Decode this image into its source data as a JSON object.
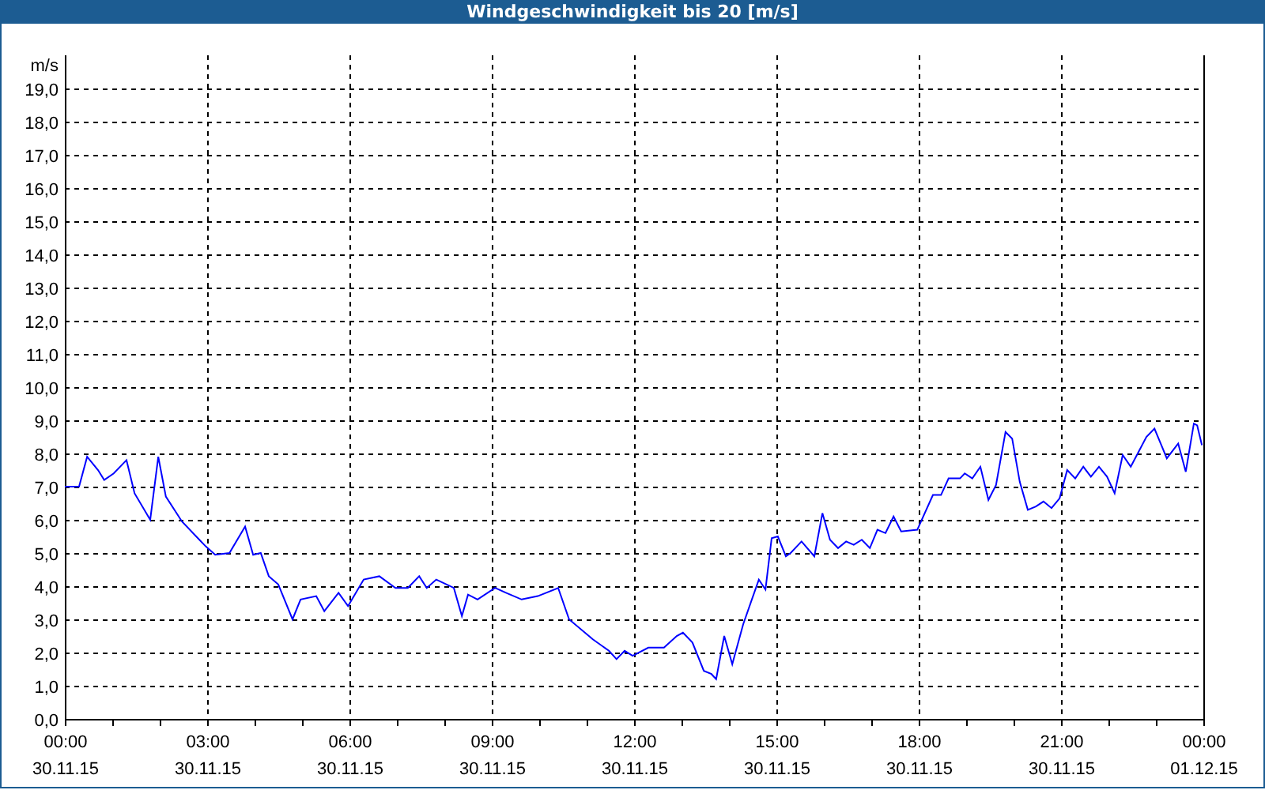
{
  "chart_data": {
    "type": "line",
    "title": "Windgeschwindigkeit bis 20 [m/s]",
    "ylabel": "m/s",
    "xlim": [
      0,
      24
    ],
    "ylim": [
      0,
      20
    ],
    "grid": true,
    "xticks": [
      {
        "value": 0,
        "label": "00:00"
      },
      {
        "value": 3,
        "label": "03:00"
      },
      {
        "value": 6,
        "label": "06:00"
      },
      {
        "value": 9,
        "label": "09:00"
      },
      {
        "value": 12,
        "label": "12:00"
      },
      {
        "value": 15,
        "label": "15:00"
      },
      {
        "value": 18,
        "label": "18:00"
      },
      {
        "value": 21,
        "label": "21:00"
      },
      {
        "value": 24,
        "label": "00:00"
      }
    ],
    "annotations": [
      "30.11.15",
      "30.11.15",
      "30.11.15",
      "30.11.15",
      "30.11.15",
      "30.11.15",
      "30.11.15",
      "30.11.15",
      "01.12.15"
    ],
    "yticks": [
      {
        "value": 0,
        "label": "0,0"
      },
      {
        "value": 1,
        "label": "1,0"
      },
      {
        "value": 2,
        "label": "2,0"
      },
      {
        "value": 3,
        "label": "3,0"
      },
      {
        "value": 4,
        "label": "4,0"
      },
      {
        "value": 5,
        "label": "5,0"
      },
      {
        "value": 6,
        "label": "6,0"
      },
      {
        "value": 7,
        "label": "7,0"
      },
      {
        "value": 8,
        "label": "8,0"
      },
      {
        "value": 9,
        "label": "9,0"
      },
      {
        "value": 10,
        "label": "10,0"
      },
      {
        "value": 11,
        "label": "11,0"
      },
      {
        "value": 12,
        "label": "12,0"
      },
      {
        "value": 13,
        "label": "13,0"
      },
      {
        "value": 14,
        "label": "14,0"
      },
      {
        "value": 15,
        "label": "15,0"
      },
      {
        "value": 16,
        "label": "16,0"
      },
      {
        "value": 17,
        "label": "17,0"
      },
      {
        "value": 18,
        "label": "18,0"
      },
      {
        "value": 19,
        "label": "19,0"
      }
    ],
    "x": [
      0,
      0.3,
      0.47,
      0.7,
      0.83,
      1.03,
      1.3,
      1.47,
      1.8,
      1.97,
      2.13,
      2.47,
      2.97,
      3.17,
      3.47,
      3.8,
      3.97,
      4.13,
      4.3,
      4.5,
      4.8,
      4.97,
      5.3,
      5.47,
      5.77,
      5.97,
      6.3,
      6.63,
      6.97,
      7.23,
      7.47,
      7.63,
      7.83,
      8.2,
      8.37,
      8.5,
      8.7,
      9.07,
      9.3,
      9.63,
      9.97,
      10.4,
      10.63,
      11.13,
      11.47,
      11.63,
      11.8,
      11.97,
      12.3,
      12.63,
      12.9,
      13.03,
      13.23,
      13.47,
      13.63,
      13.73,
      13.9,
      14.07,
      14.3,
      14.63,
      14.77,
      14.9,
      15.03,
      15.2,
      15.3,
      15.53,
      15.8,
      15.97,
      16.13,
      16.3,
      16.47,
      16.63,
      16.8,
      16.97,
      17.13,
      17.3,
      17.47,
      17.63,
      17.97,
      18.3,
      18.47,
      18.63,
      18.87,
      18.97,
      19.13,
      19.3,
      19.47,
      19.63,
      19.83,
      19.97,
      20.13,
      20.3,
      20.47,
      20.63,
      20.8,
      20.97,
      21.13,
      21.3,
      21.47,
      21.63,
      21.8,
      21.97,
      22.13,
      22.3,
      22.47,
      22.8,
      22.97,
      23.13,
      23.23,
      23.47,
      23.63,
      23.8,
      23.87,
      23.97
    ],
    "series": [
      {
        "color": "#0000ff",
        "values": [
          7.0,
          7.0,
          7.9,
          7.5,
          7.2,
          7.4,
          7.8,
          6.8,
          6.0,
          7.9,
          6.7,
          5.95,
          5.2,
          4.95,
          5.0,
          5.8,
          4.95,
          5.0,
          4.3,
          4.05,
          3.0,
          3.6,
          3.7,
          3.25,
          3.8,
          3.4,
          4.2,
          4.3,
          3.95,
          3.95,
          4.3,
          3.95,
          4.2,
          3.95,
          3.1,
          3.75,
          3.6,
          3.95,
          3.8,
          3.6,
          3.7,
          3.95,
          3.0,
          2.4,
          2.05,
          1.8,
          2.05,
          1.9,
          2.15,
          2.15,
          2.5,
          2.6,
          2.3,
          1.45,
          1.35,
          1.2,
          2.5,
          1.65,
          2.85,
          4.2,
          3.9,
          5.45,
          5.5,
          4.9,
          5.0,
          5.35,
          4.9,
          6.2,
          5.4,
          5.15,
          5.35,
          5.25,
          5.4,
          5.15,
          5.7,
          5.6,
          6.1,
          5.65,
          5.7,
          6.75,
          6.75,
          7.25,
          7.25,
          7.4,
          7.25,
          7.6,
          6.6,
          7.05,
          8.65,
          8.45,
          7.15,
          6.3,
          6.4,
          6.55,
          6.35,
          6.65,
          7.5,
          7.25,
          7.6,
          7.3,
          7.6,
          7.3,
          6.8,
          7.95,
          7.6,
          8.5,
          8.75,
          8.2,
          7.85,
          8.3,
          7.45,
          8.9,
          8.85,
          8.25
        ]
      }
    ]
  }
}
